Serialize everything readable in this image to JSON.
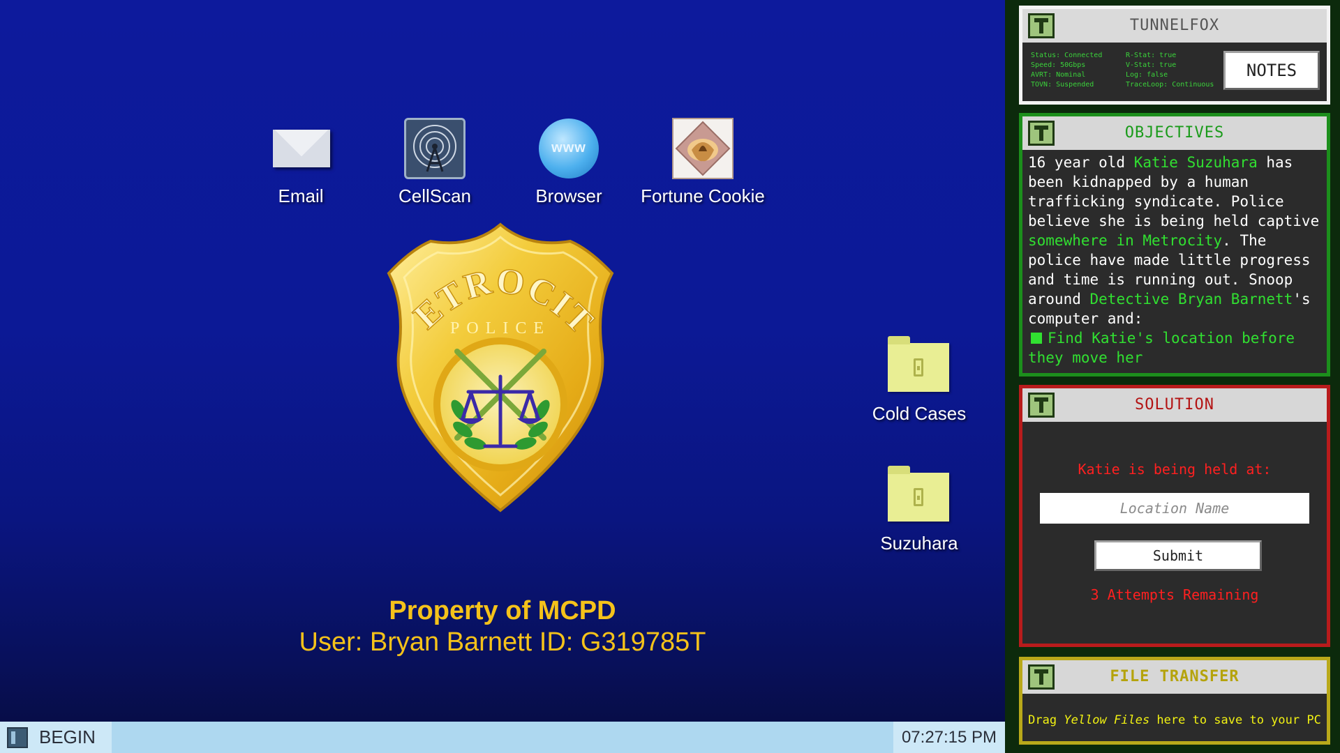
{
  "desktop": {
    "icons": [
      {
        "label": "Email"
      },
      {
        "label": "CellScan"
      },
      {
        "label": "Browser",
        "glyph_text": "www"
      },
      {
        "label": "Fortune Cookie"
      },
      {
        "label": "Cold Cases"
      },
      {
        "label": "Suzuhara"
      }
    ],
    "badge": {
      "top_text": "METROCITY",
      "sub_text": "POLICE"
    },
    "property_line": "Property of MCPD",
    "user_line": "User: Bryan Barnett ID: G319785T"
  },
  "taskbar": {
    "begin_label": "BEGIN",
    "clock": "07:27:15 PM"
  },
  "tunnelfox": {
    "title": "TUNNELFOX",
    "stats_left": [
      "Status: Connected",
      "Speed: 50Gbps",
      "AVRT: Nominal",
      "TOVN: Suspended"
    ],
    "stats_right": [
      "R-Stat: true",
      "V-Stat: true",
      "Log: false",
      "TraceLoop: Continuous"
    ],
    "notes_label": "NOTES"
  },
  "objectives": {
    "title": "OBJECTIVES",
    "p1": "16 year old ",
    "name": "Katie Suzuhara",
    "p2": " has been kidnapped by a human trafficking syndicate. Police believe she is being held captive ",
    "place": "somewhere in Metrocity",
    "p3": ". The police have made little progress and time is running out. Snoop around ",
    "detective": "Detective Bryan Barnett",
    "p4": "'s computer and:",
    "task": "Find Katie's location before they move her"
  },
  "solution": {
    "title": "SOLUTION",
    "prompt": "Katie is being held at:",
    "input_placeholder": "Location Name",
    "input_value": "",
    "submit_label": "Submit",
    "attempts": "3 Attempts Remaining"
  },
  "file_transfer": {
    "title": "FILE TRANSFER",
    "text_before": "Drag ",
    "text_em": "Yellow Files",
    "text_after": " here to save to your PC"
  },
  "colors": {
    "desktop_blue": "#0c1996",
    "badge_gold": "#f5c21a",
    "objectives_green": "#1c8f1c",
    "solution_red": "#b81c1c",
    "transfer_yellow": "#b9a91a",
    "taskbar_blue": "#aed8f0"
  }
}
